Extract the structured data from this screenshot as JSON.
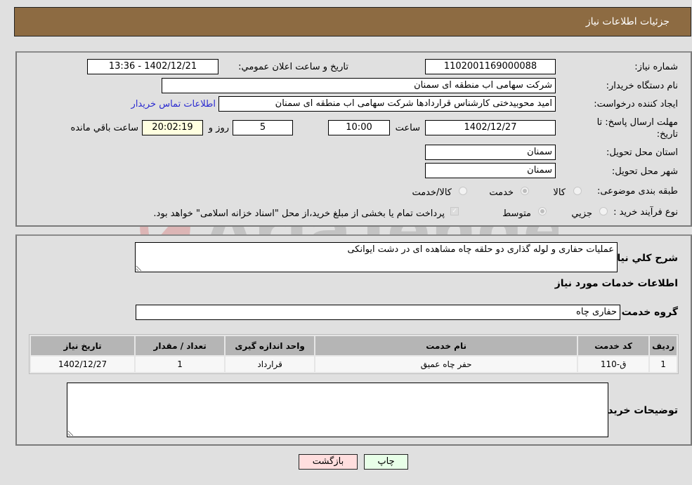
{
  "header": {
    "title": "جزئیات اطلاعات نیاز"
  },
  "info": {
    "need_number": {
      "label": "شماره نیاز:",
      "value": "1102001169000088"
    },
    "announce_datetime": {
      "label": "تاريخ و ساعت اعلان عمومي:",
      "value": "1402/12/21 - 13:36"
    },
    "buyer_org": {
      "label": "نام دستگاه خريدار:",
      "value": "شرکت سهامی اب منطقه ای سمنان"
    },
    "requester": {
      "label": "ايجاد کننده درخواست:",
      "value": "امید محوبیدختی کارشناس قراردادها شرکت سهامی اب منطقه ای سمنان"
    },
    "buyer_contact_link": "اطلاعات تماس خريدار",
    "deadline": {
      "label": "مهلت ارسال پاسخ: تا تاريخ:",
      "date": "1402/12/27",
      "time_label": "ساعت",
      "time": "10:00",
      "days": "5",
      "days_label": "روز و",
      "remaining": "20:02:19",
      "remaining_label": "ساعت باقي مانده"
    },
    "delivery_province": {
      "label": "استان محل تحويل:",
      "value": "سمنان"
    },
    "delivery_city": {
      "label": "شهر محل تحويل:",
      "value": "سمنان"
    },
    "category": {
      "label": "طبقه بندی موضوعی:",
      "options": [
        {
          "label": "کالا",
          "selected": false
        },
        {
          "label": "خدمت",
          "selected": true
        },
        {
          "label": "کالا/خدمت",
          "selected": false
        }
      ]
    },
    "purchase_process": {
      "label": "نوع فرآيند خريد :",
      "options": [
        {
          "label": "جزيي",
          "selected": false
        },
        {
          "label": "متوسط",
          "selected": true
        }
      ],
      "treasury_note": "پرداخت تمام يا بخشی از مبلغ خريد،از محل \"اسناد خزانه اسلامی\" خواهد بود.",
      "treasury_checked": true
    }
  },
  "details": {
    "description_label": "شرح کلي نياز:",
    "description": "عملیات حفاری و لوله گذاری دو حلقه چاه مشاهده ای در دشت ایوانکی",
    "services_heading": "اطلاعات خدمات مورد نياز",
    "service_group_label": "گروه خدمت:",
    "service_group": "حفاری چاه",
    "table": {
      "headers": [
        "رديف",
        "کد خدمت",
        "نام خدمت",
        "واحد اندازه گيری",
        "تعداد / مقدار",
        "تاريخ نياز"
      ],
      "rows": [
        [
          "1",
          "ق-110",
          "حفر چاه عمیق",
          "قرارداد",
          "1",
          "1402/12/27"
        ]
      ]
    },
    "buyer_notes_label": "توضيحات خريدار:",
    "buyer_notes": ""
  },
  "actions": {
    "print": "چاپ",
    "back": "بازگشت"
  },
  "watermark": {
    "text": "AriaTender.neT"
  },
  "colors": {
    "header_bg": "#8d6b42",
    "print_btn_bg": "#e8ffe8",
    "back_btn_bg": "#ffdede",
    "remaining_bg": "#ffffe0",
    "link": "#2a2ad0"
  }
}
